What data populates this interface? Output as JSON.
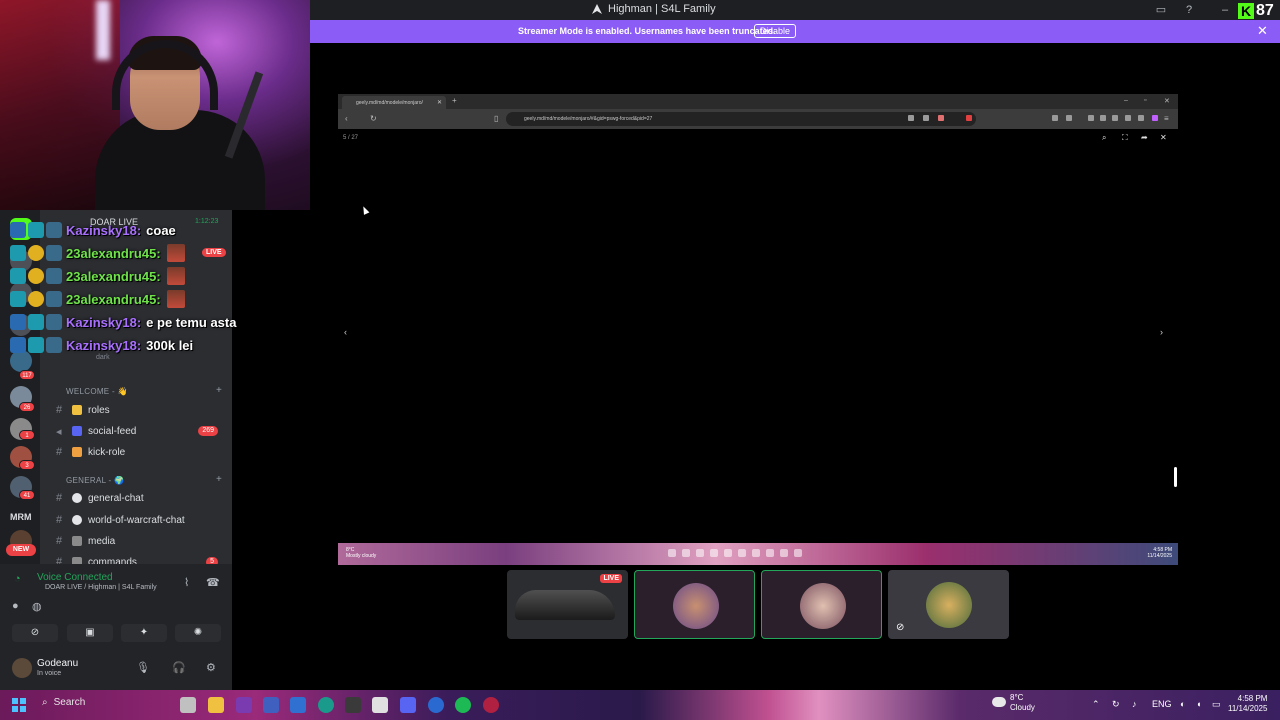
{
  "window": {
    "title": "Highman | S4L Family",
    "kick_viewers": "87"
  },
  "banner": {
    "text": "Streamer Mode is enabled. Usernames have been truncated.",
    "button": "Disable"
  },
  "browser": {
    "tab_title": "geely.md/md/modele/monjaro/",
    "url": "geely.md/md/modele/monjaro/#&gid=pswg-forced&pid=27",
    "counter": "5 / 27",
    "taskbar_weather_temp": "8°C",
    "taskbar_weather_desc": "Mostly cloudy",
    "taskbar_time": "4:58 PM",
    "taskbar_date": "11/14/2025"
  },
  "chat": [
    {
      "user": "Kazinsky18:",
      "text": "coae",
      "color": "#a970ff"
    },
    {
      "user": "23alexandru45:",
      "text": "",
      "color": "#6fe34a"
    },
    {
      "user": "23alexandru45:",
      "text": "",
      "color": "#6fe34a"
    },
    {
      "user": "23alexandru45:",
      "text": "",
      "color": "#6fe34a"
    },
    {
      "user": "Kazinsky18:",
      "text": "e pe temu asta",
      "color": "#a970ff"
    },
    {
      "user": "Kazinsky18:",
      "text": "300k lei",
      "color": "#a970ff"
    }
  ],
  "sidebar": {
    "voice_channel_name": "DOAR LIVE",
    "voice_timer": "1:12:23",
    "live_label": "LIVE",
    "voice_user": "dark",
    "server_badges": [
      "117",
      "26",
      "1",
      "3",
      "41"
    ],
    "server_text": "MRM",
    "new_label": "NEW",
    "category_welcome": "WELCOME - 👋",
    "category_general": "GENERAL - 🌍",
    "channels_welcome": [
      {
        "name": "roles",
        "badge": ""
      },
      {
        "name": "social-feed",
        "badge": "269"
      },
      {
        "name": "kick-role",
        "badge": ""
      }
    ],
    "channels_general": [
      {
        "name": "general-chat",
        "badge": ""
      },
      {
        "name": "world-of-warcraft-chat",
        "badge": ""
      },
      {
        "name": "media",
        "badge": ""
      },
      {
        "name": "commands",
        "badge": "5"
      }
    ]
  },
  "voice_panel": {
    "status": "Voice Connected",
    "location": "DOAR LIVE / Highman | S4L Family",
    "username": "Godeanu",
    "user_status": "In voice"
  },
  "tiles": {
    "live_label": "LIVE"
  },
  "taskbar": {
    "search_label": "Search",
    "weather_temp": "8°C",
    "weather_desc": "Cloudy",
    "language": "ENG",
    "time": "4:58 PM",
    "date": "11/14/2025"
  },
  "colors": {
    "banner": "#8b5cf6",
    "online_green": "#23a55a",
    "badge_red": "#ed4245",
    "kick_green": "#53fc18"
  }
}
